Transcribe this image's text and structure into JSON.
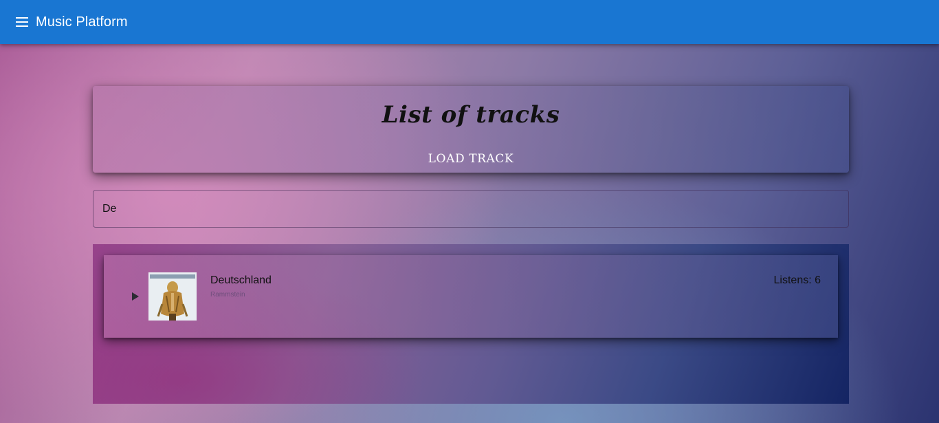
{
  "appbar": {
    "title": "Music Platform",
    "icon": "menu-icon"
  },
  "header": {
    "title": "List of tracks",
    "load_button": "LOAD TRACK"
  },
  "search": {
    "value": "De"
  },
  "tracks": [
    {
      "name": "Deutschland",
      "artist": "Rammstein",
      "listens_label": "Listens: 6",
      "cover_text": "RAMMSTEIN"
    }
  ],
  "colors": {
    "appbar": "#1976d2",
    "text": "#111111"
  }
}
